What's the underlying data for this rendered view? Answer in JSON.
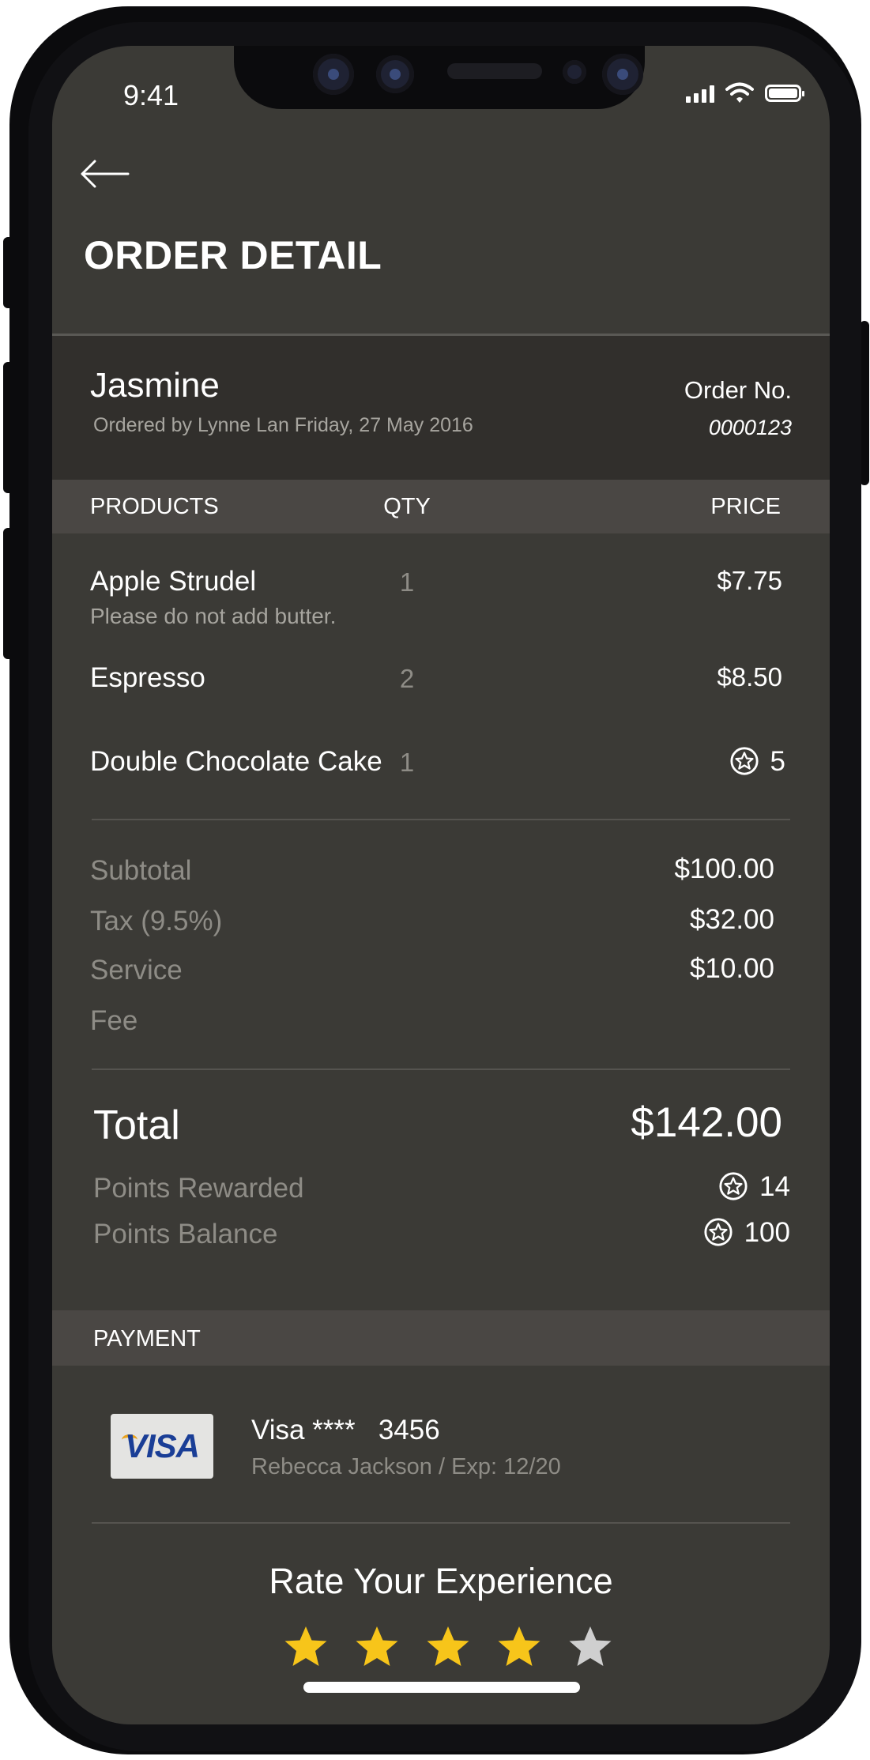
{
  "status_bar": {
    "time": "9:41"
  },
  "header": {
    "title": "ORDER DETAIL",
    "back_icon": "arrow-left-icon"
  },
  "order": {
    "customer": "Jasmine",
    "ordered_by": "Ordered by Lynne Lan  Friday, 27 May 2016",
    "order_no_label": "Order No.",
    "order_no": "0000123"
  },
  "table": {
    "headers": {
      "products": "PRODUCTS",
      "qty": "QTY",
      "price": "PRICE"
    },
    "items": [
      {
        "name": "Apple Strudel",
        "note": "Please do not add butter.",
        "qty": "1",
        "price": "$7.75",
        "points_price": false
      },
      {
        "name": "Espresso",
        "note": "",
        "qty": "2",
        "price": "$8.50",
        "points_price": false
      },
      {
        "name": "Double Chocolate Cake",
        "note": "",
        "qty": "1",
        "price": "5",
        "points_price": true
      }
    ]
  },
  "summary": {
    "subtotal_label": "Subtotal",
    "subtotal": "$100.00",
    "tax_label": "Tax (9.5%)",
    "tax": "$32.00",
    "service_label": "Service",
    "service_label_2": "Fee",
    "service": "$10.00",
    "total_label": "Total",
    "total": "$142.00",
    "points_rewarded_label": "Points Rewarded",
    "points_rewarded": "14",
    "points_balance_label": "Points Balance",
    "points_balance": "100"
  },
  "payment": {
    "header": "PAYMENT",
    "card_brand": "VISA",
    "card_line": "Visa ****   3456",
    "card_holder": "Rebecca Jackson / Exp: 12/20"
  },
  "rating": {
    "prompt": "Rate Your Experience",
    "stars_filled": 4,
    "stars_total": 5,
    "filled_color": "#f7c51a",
    "empty_color": "#cfcfcf"
  },
  "colors": {
    "screen_bg": "#3b3a36",
    "header_bg": "#312f2c",
    "band_bg": "#4a4744",
    "muted_text": "#8e8c86"
  }
}
